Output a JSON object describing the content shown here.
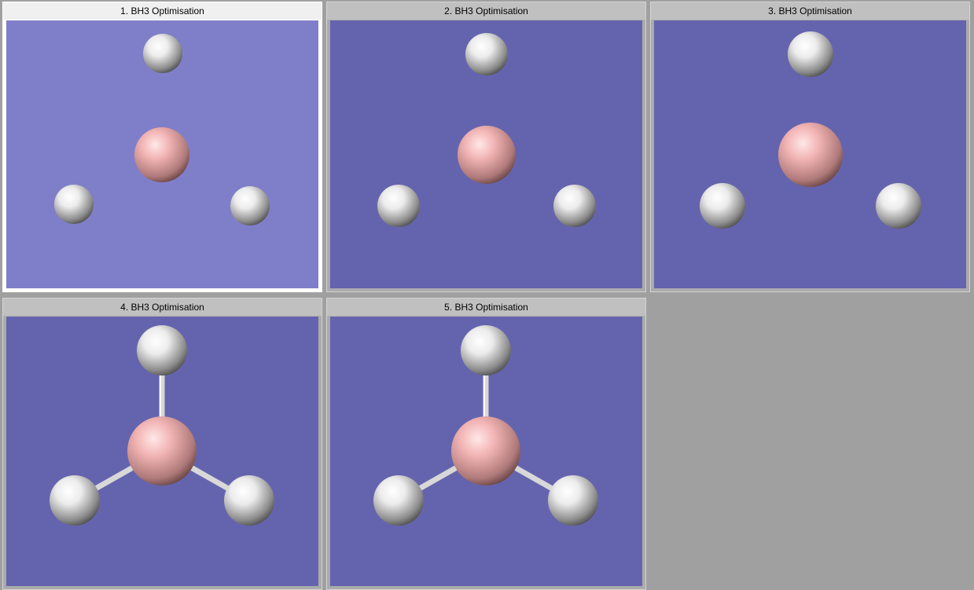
{
  "window": {
    "panels": [
      {
        "title": "1.  BH3 Optimisation",
        "active": true,
        "bonds_visible": false
      },
      {
        "title": "2.  BH3 Optimisation",
        "active": false,
        "bonds_visible": false
      },
      {
        "title": "3.  BH3 Optimisation",
        "active": false,
        "bonds_visible": false
      },
      {
        "title": "4.  BH3 Optimisation",
        "active": false,
        "bonds_visible": true
      },
      {
        "title": "5.  BH3 Optimisation",
        "active": false,
        "bonds_visible": true
      }
    ]
  },
  "colors": {
    "viewport_background": "#6464ae",
    "active_viewport_background": "#7f7fc9",
    "boron_atom": "#f2b4b4",
    "hydrogen_atom": "#f0f0f0",
    "bond": "#d8d8d8"
  },
  "atoms": {
    "central": "boron",
    "terminal": [
      "hydrogen",
      "hydrogen",
      "hydrogen"
    ]
  }
}
